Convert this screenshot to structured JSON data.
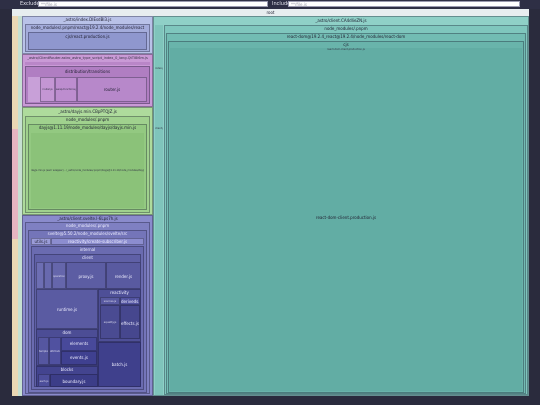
{
  "filter": {
    "exclude_label": "Exclude",
    "exclude_placeholder": "**/file.js",
    "include_label": "Include",
    "include_placeholder": "**/file.js"
  },
  "root": {
    "label": "root"
  },
  "left": {
    "astro_index": "_astro/index.DIEsdBl3.js",
    "node_modules_react": "node_modules/.pnpm/react@19.2.4/node_modules/react",
    "cjs_react_prod": "cjs/react.production.js",
    "astro_client_render": "_astro/ClientRouter.astro_astro_type_script_index_0_lang.QtTI8i6m.js",
    "distribution": "distribution/transitions",
    "router_js": "router.js",
    "router_small": "router.js",
    "router_small2": "swap-functions.js",
    "astro_dayjs": "_astro/dayjs.min.CBpPTQJZ.js",
    "dayjs_node_modules": "node_modules/.pnpm",
    "dayjs_pkg": "dayjs@1.11.19/node_modules/dayjs/dayjs.min.js",
    "dayjs_inner": "dayjs.min.js (esm wrapper) – /_astro/node_modules/.pnpm/dayjs@1.11.19/node_modules/dayjs/dayjs.min.js",
    "astro_svelte": "_astro/client.svelte.l-6Lps7h.js",
    "svelte_node_modules": "node_modules/.pnpm",
    "svelte_pkg": "svelte@5.50.2/node_modules/svelte/src",
    "utils_js": "utils.js",
    "reactivity_create": "reactivity/create-subscriber.js",
    "internal": "internal",
    "client": "client",
    "proxy_js": "proxy.js",
    "render_js": "render.js",
    "reactivity": "reactivity",
    "deriveds_js": "deriveds.js",
    "effects_js": "effects.js",
    "runtime_js": "runtime.js",
    "dom": "dom",
    "elements": "elements",
    "events_js": "events.js",
    "blocks": "blocks",
    "boundary_js": "boundary.js",
    "batch_js": "batch.js",
    "tiny_labels": [
      "sources.js",
      "equality.js",
      "operations.js",
      "template.js",
      "attributes.js",
      "bindings.js",
      "each.js",
      "if.js"
    ]
  },
  "right": {
    "astro_client": "_astro/client.CA4dlieZN.js",
    "node_modules": "node_modules/.pnpm",
    "react_dom_pkg": "react-dom@19.2.4_react@19.2.4/node_modules/react-dom",
    "cjs": "cjs",
    "react_dom_client_small": "react-dom-client.production.js",
    "react_dom_client": "react-dom-client.production.js",
    "side_label_1": "index.js",
    "side_label_2": "client.js"
  },
  "colors": {
    "background": "#2a2b3d",
    "root": "#e7edef",
    "react": "#b9c2e8",
    "astro_router": "#c99ad6",
    "dayjs": "#9cd18a",
    "svelte": "#6f70b8",
    "react_dom": "#6cb5ae"
  }
}
